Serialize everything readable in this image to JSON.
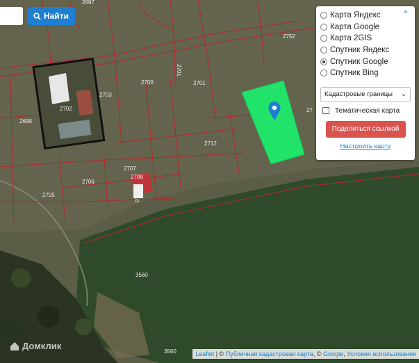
{
  "search": {
    "button_label": "Найти"
  },
  "layers_panel": {
    "options": [
      {
        "label": "Карта Яндекс",
        "selected": false
      },
      {
        "label": "Карта Google",
        "selected": false
      },
      {
        "label": "Карта 2GIS",
        "selected": false
      },
      {
        "label": "Спутник Яндекс",
        "selected": false
      },
      {
        "label": "Спутник Google",
        "selected": true
      },
      {
        "label": "Спутник Bing",
        "selected": false
      }
    ],
    "overlay_select": "Кадастровые границы",
    "thematic_map_label": "Тематическая карта",
    "thematic_map_checked": false,
    "share_button": "Поделиться ссылкой",
    "configure_link": "Настроить карту"
  },
  "parcels": {
    "p2697": "2697",
    "p2752": "2752",
    "p2703": "2703",
    "p2700": "2700",
    "p2701a": "2701",
    "p2701b": "2701",
    "p2702": "2702",
    "p2699": "2699",
    "p2712": "2712",
    "p2707": "2707",
    "p2706": "2706",
    "p2705": "2705",
    "p3560a": "3560",
    "p3560b": "3560",
    "p27xx": "27",
    "p2708": "2708",
    "p2710": "2710"
  },
  "attribution": {
    "leaflet": "Leaflet",
    "sep1": " | © ",
    "pkk": "Публичная кадастровая карта",
    "sep2": ", © ",
    "google": "Google",
    "sep3": ", ",
    "terms": "Условия использования"
  },
  "watermark": "Домклик",
  "colors": {
    "highlight": "#22e36a",
    "boundary": "#b3262b",
    "accent": "#1e7fd0",
    "share": "#d9534f"
  }
}
